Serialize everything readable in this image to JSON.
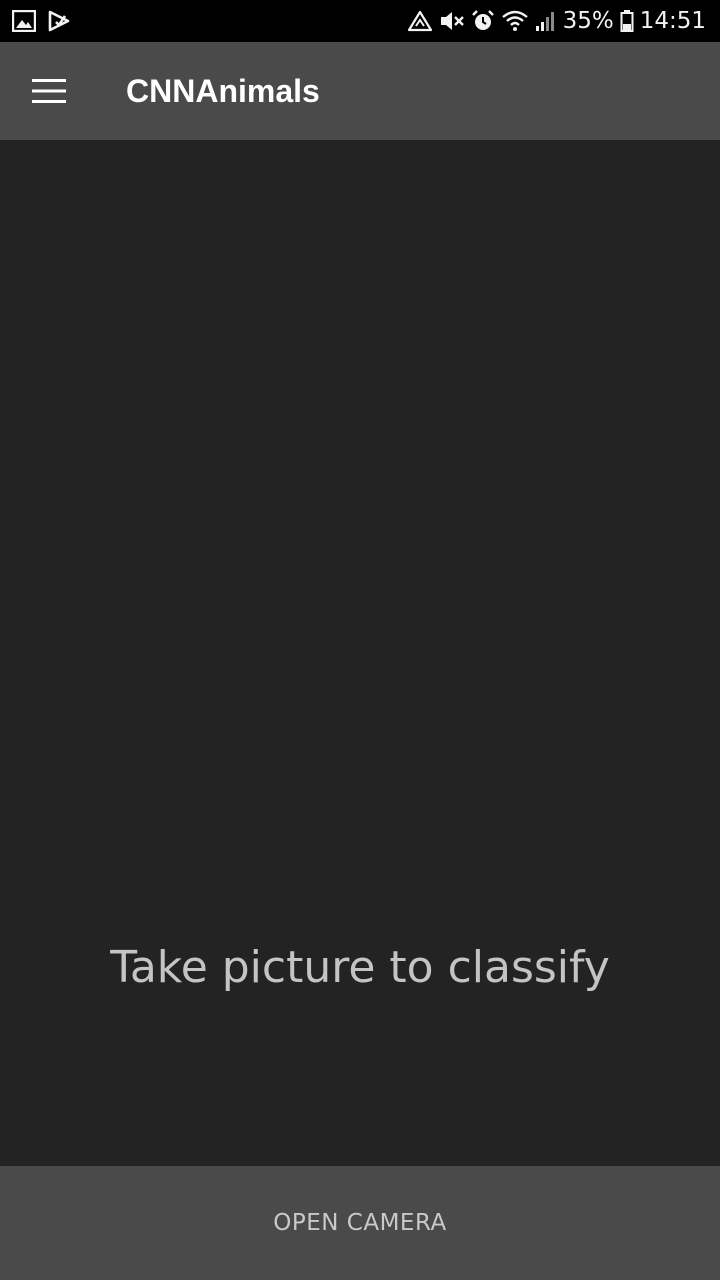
{
  "status_bar": {
    "left_icons": [
      "gallery-icon",
      "play-store-icon"
    ],
    "right_icons": [
      "data-saver-icon",
      "mute-icon",
      "alarm-icon",
      "wifi-icon",
      "signal-icon"
    ],
    "battery_percent": "35%",
    "battery_icon": "battery-icon",
    "time": "14:51"
  },
  "app_bar": {
    "menu_icon": "hamburger-menu-icon",
    "title": "CNNAnimals"
  },
  "main": {
    "result_text": "Take picture to classify"
  },
  "bottom": {
    "button_label": "OPEN CAMERA"
  },
  "colors": {
    "background": "#232323",
    "app_bar": "#4a4a4a",
    "status_bar": "#000000",
    "text_secondary": "#c4c4c4"
  }
}
